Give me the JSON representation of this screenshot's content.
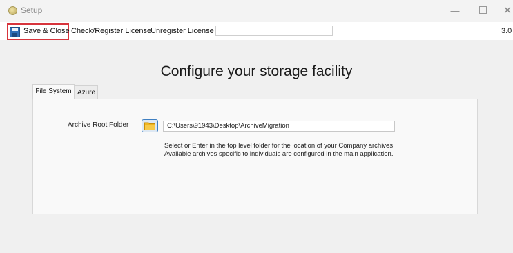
{
  "window": {
    "title": "Setup",
    "icon": "app-icon",
    "controls": {
      "minimize": "—",
      "maximize": "",
      "close": "✕"
    }
  },
  "toolbar": {
    "save_label": "Save & Close",
    "save_icon": "floppy-disk-icon",
    "check_license_label": "Check/Register License",
    "unregister_license_label": "Unregister License",
    "license_input_value": "",
    "version": "3.0",
    "highlight_color": "#d7343c"
  },
  "main": {
    "heading": "Configure your storage facility",
    "tabs": [
      {
        "label": "File System",
        "active": true
      },
      {
        "label": "Azure",
        "active": false
      }
    ],
    "file_system": {
      "field_label": "Archive Root Folder",
      "folder_icon": "folder-icon",
      "path_value": "C:\\Users\\91943\\Desktop\\ArchiveMigration",
      "help_line1": "Select or Enter in the top level folder for the location of your Company archives.",
      "help_line2": "Available archives specific to individuals are configured in the main application."
    }
  }
}
